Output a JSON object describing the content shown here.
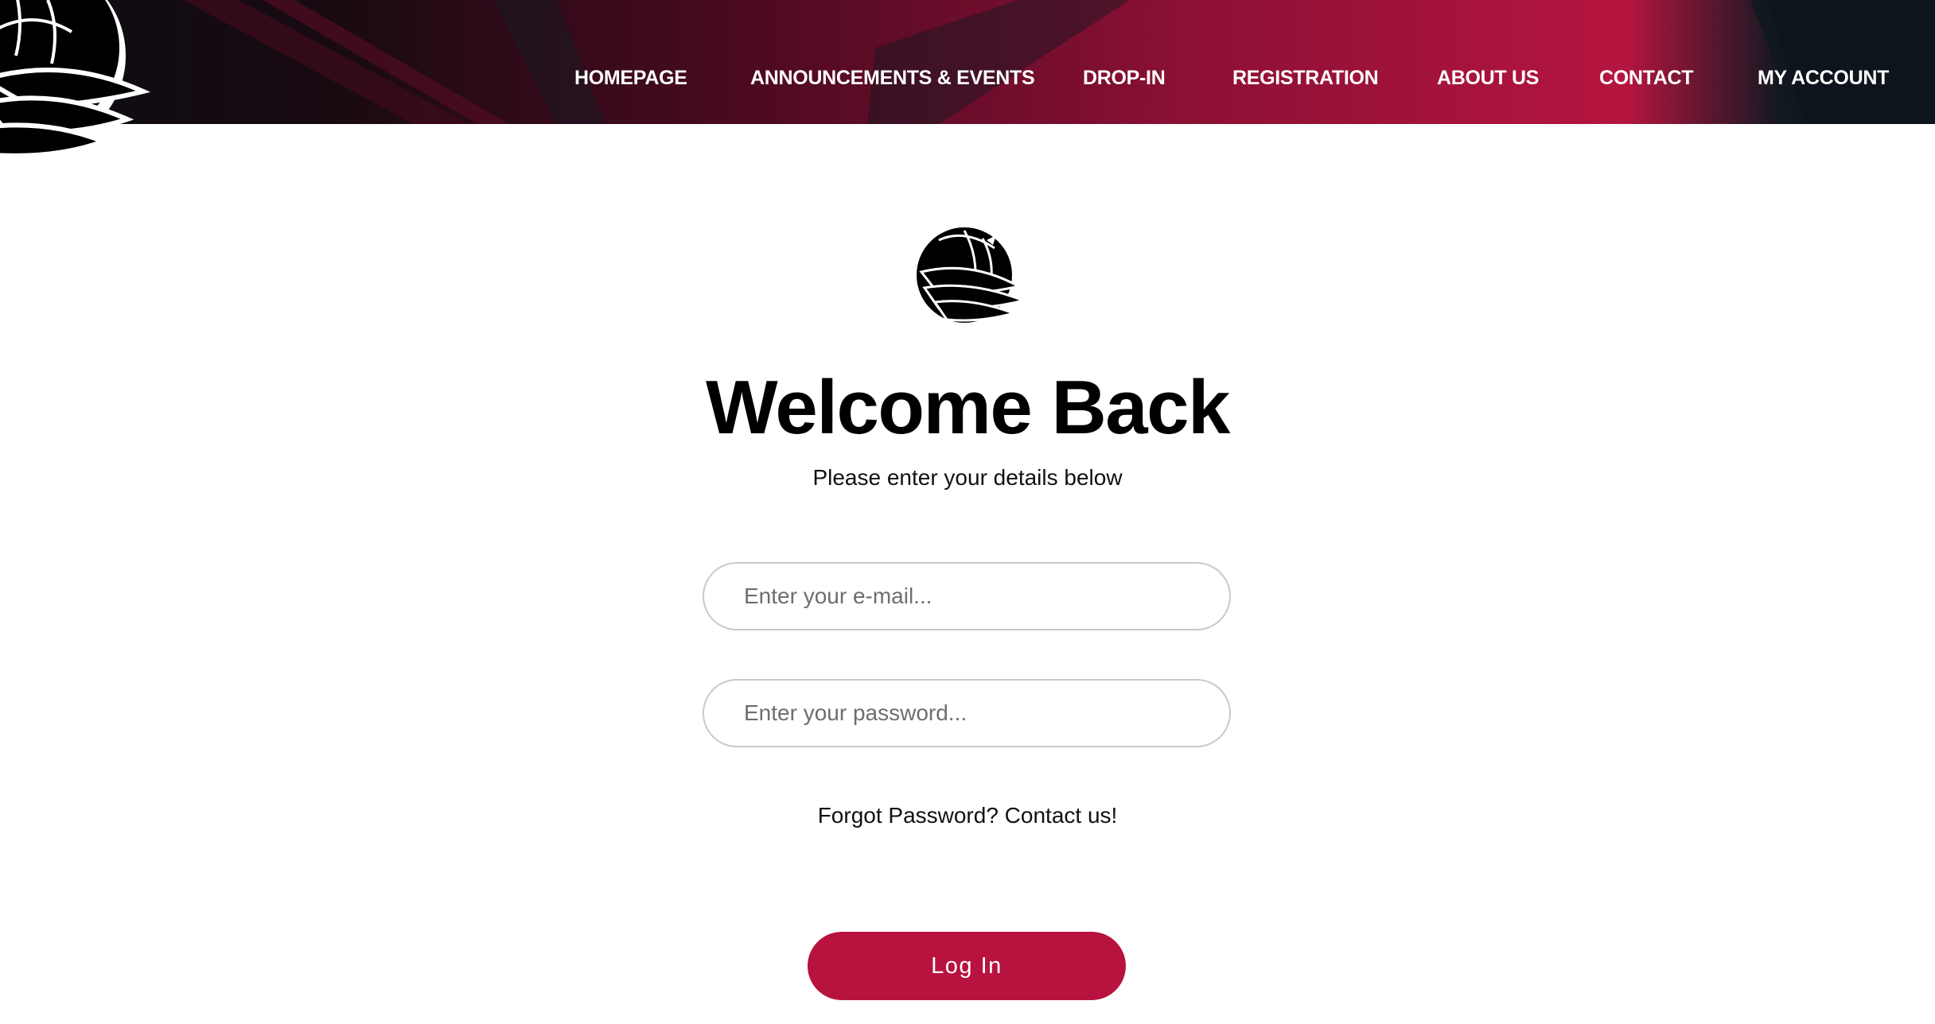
{
  "colors": {
    "brand_primary": "#b8123f",
    "header_dark": "#0b0d12",
    "text": "#000000",
    "input_border": "#c9c9c9"
  },
  "header": {
    "logo_icon": "raven-volleyball-logo-icon",
    "nav": [
      {
        "label": "HOMEPAGE"
      },
      {
        "label": "ANNOUNCEMENTS & EVENTS"
      },
      {
        "label": "DROP-IN"
      },
      {
        "label": "REGISTRATION"
      },
      {
        "label": "ABOUT US"
      },
      {
        "label": "CONTACT"
      },
      {
        "label": "MY ACCOUNT"
      }
    ]
  },
  "login": {
    "logo_icon": "raven-volleyball-logo-icon",
    "title": "Welcome Back",
    "subtitle": "Please enter your details below",
    "email": {
      "value": "",
      "placeholder": "Enter your e-mail..."
    },
    "password": {
      "value": "",
      "placeholder": "Enter your password..."
    },
    "forgot_text": "Forgot Password? Contact us!",
    "submit_label": "Log In"
  }
}
